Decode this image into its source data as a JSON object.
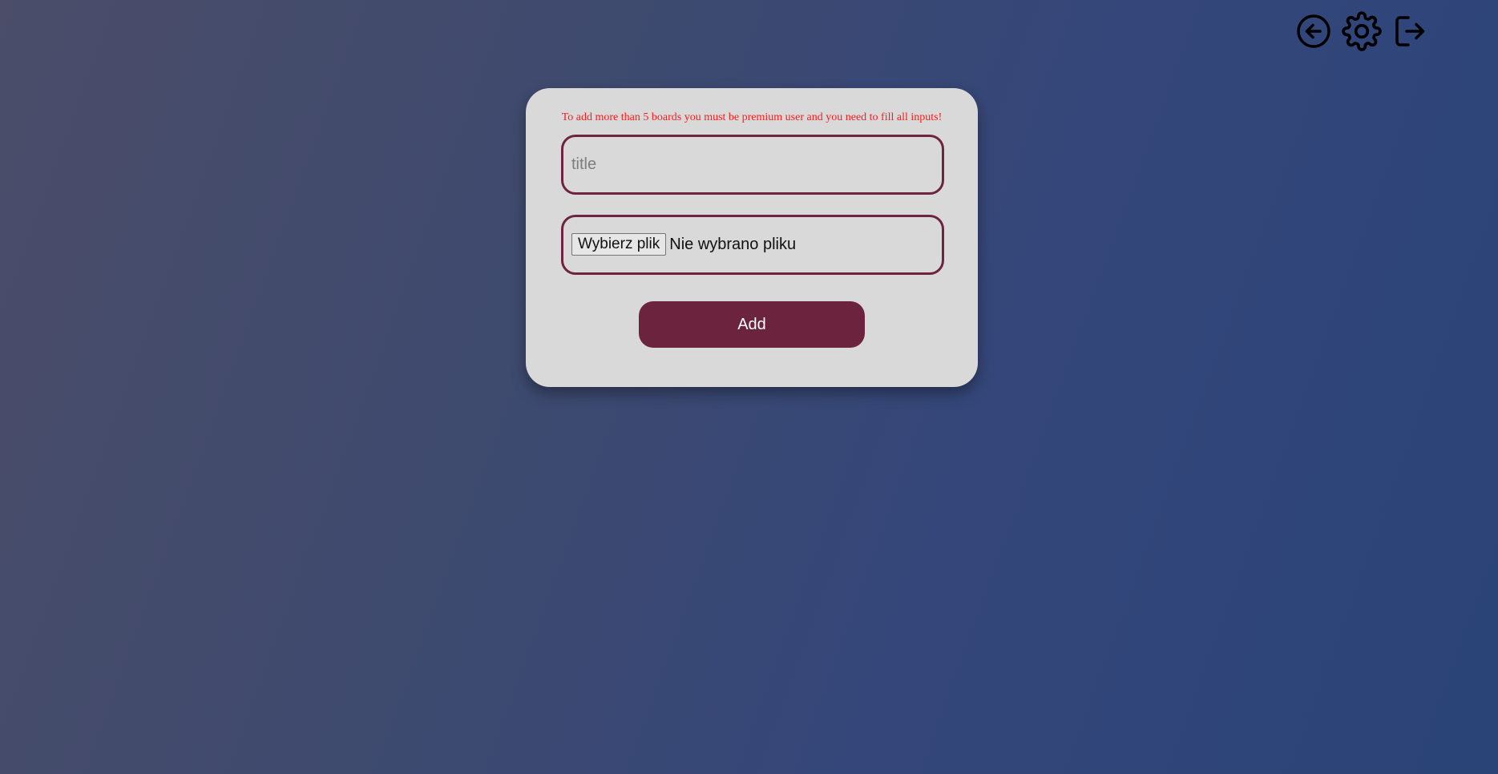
{
  "toolbar": {
    "back_icon": "arrow-left-circle-icon",
    "settings_icon": "gear-icon",
    "logout_icon": "logout-icon"
  },
  "form": {
    "notice": "To add more than 5 boards you must be premium user and you need to fill all inputs!",
    "title_placeholder": "title",
    "title_value": "",
    "file_button_label": "Wybierz plik",
    "file_status": "Nie wybrano pliku",
    "submit_label": "Add"
  },
  "colors": {
    "accent": "#6c233d",
    "notice": "#ff1a1a",
    "card": "#d9d9d9"
  }
}
